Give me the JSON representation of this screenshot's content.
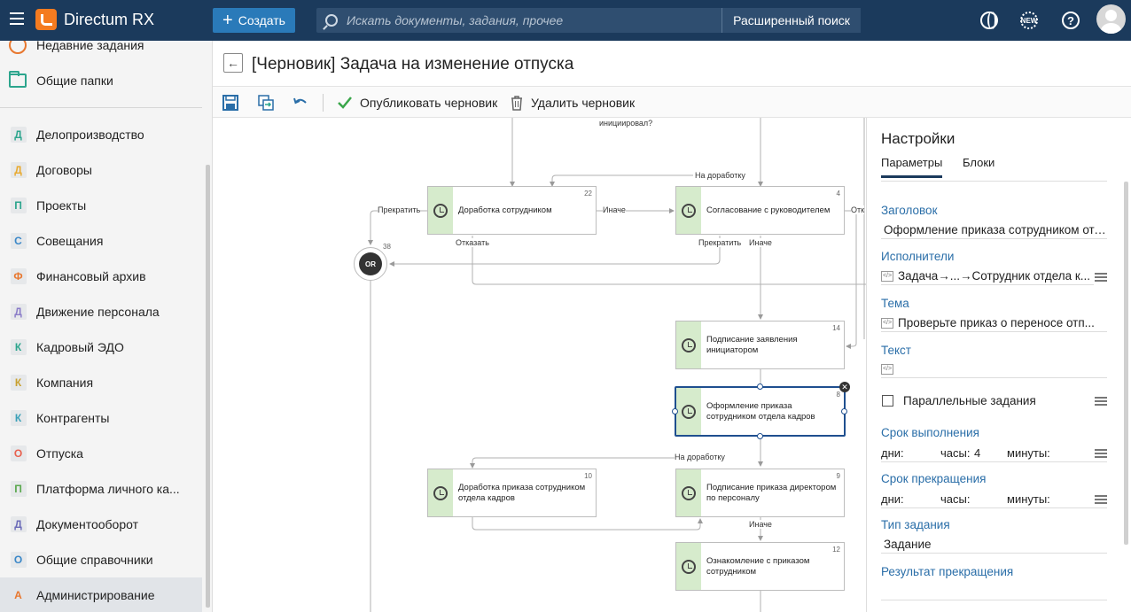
{
  "app": {
    "logo_text": "Directum RX",
    "create_label": "Создать",
    "search_placeholder": "Искать документы, задания, прочее",
    "advanced_search_label": "Расширенный поиск",
    "new_badge": "NEW",
    "help_symbol": "?"
  },
  "sidebar": {
    "top_items": [
      {
        "label": "Недавние задания",
        "icon": "clock-icon"
      },
      {
        "label": "Общие папки",
        "icon": "folder-icon"
      }
    ],
    "items": [
      {
        "letter": "Д",
        "label": "Делопроизводство",
        "color": "#2ca58d"
      },
      {
        "letter": "Д",
        "label": "Договоры",
        "color": "#e8a92e"
      },
      {
        "letter": "П",
        "label": "Проекты",
        "color": "#2ca58d"
      },
      {
        "letter": "С",
        "label": "Совещания",
        "color": "#3a87c8"
      },
      {
        "letter": "Ф",
        "label": "Финансовый архив",
        "color": "#e8772e"
      },
      {
        "letter": "Д",
        "label": "Движение персонала",
        "color": "#8a7cc8"
      },
      {
        "letter": "К",
        "label": "Кадровый ЭДО",
        "color": "#2ca58d"
      },
      {
        "letter": "К",
        "label": "Компания",
        "color": "#c8a02e"
      },
      {
        "letter": "К",
        "label": "Контрагенты",
        "color": "#3aa0b8"
      },
      {
        "letter": "О",
        "label": "Отпуска",
        "color": "#e8604e"
      },
      {
        "letter": "П",
        "label": "Платформа личного ка...",
        "color": "#5aa84e"
      },
      {
        "letter": "Д",
        "label": "Документооборот",
        "color": "#6a6ab8"
      },
      {
        "letter": "О",
        "label": "Общие справочники",
        "color": "#3a87c8"
      },
      {
        "letter": "А",
        "label": "Администрирование",
        "color": "#e8772e"
      }
    ]
  },
  "header": {
    "title": "[Черновик] Задача на изменение отпуска"
  },
  "toolbar": {
    "publish_label": "Опубликовать черновик",
    "delete_label": "Удалить черновик"
  },
  "scheme": {
    "blocks": [
      {
        "id": "b22",
        "num": "22",
        "title": "Доработка сотрудником"
      },
      {
        "id": "b4",
        "num": "4",
        "title": "Согласование с руководителем"
      },
      {
        "id": "b14",
        "num": "14",
        "title": "Подписание заявления инициатором"
      },
      {
        "id": "b8",
        "num": "8",
        "title": "Оформление приказа сотрудником отдела кадров"
      },
      {
        "id": "b10",
        "num": "10",
        "title": "Доработка приказа сотрудником отдела кадров"
      },
      {
        "id": "b9",
        "num": "9",
        "title": "Подписание приказа директором по персоналу"
      },
      {
        "id": "b12",
        "num": "12",
        "title": "Ознакомление с приказом сотрудником"
      }
    ],
    "or_node": {
      "label": "OR",
      "num": "38"
    },
    "edge_labels": {
      "initiated": "инициировал?",
      "rework_top": "На доработку",
      "stop_left": "Прекратить",
      "otherwise_1": "Иначе",
      "otk": "Отк",
      "refuse": "Отказать",
      "stop_mid": "Прекратить",
      "otherwise_2": "Иначе",
      "rework_mid": "На доработку",
      "otherwise_3": "Иначе"
    }
  },
  "panel": {
    "title": "Настройки",
    "tabs": [
      "Параметры",
      "Блоки"
    ],
    "fields": {
      "heading_label": "Заголовок",
      "heading_value": "Оформление приказа сотрудником отдела кадров",
      "performers_label": "Исполнители",
      "performers_value": "Задача→...→Сотрудник отдела к...",
      "subject_label": "Тема",
      "subject_value": "Проверьте приказ о переносе отп...",
      "text_label": "Текст",
      "text_value": "",
      "parallel_label": "Параллельные задания",
      "deadline_label": "Срок выполнения",
      "days_label": "дни:",
      "hours_label": "часы:",
      "hours_value": "4",
      "minutes_label": "минуты:",
      "abort_label": "Срок прекращения",
      "abort_days_label": "дни:",
      "abort_hours_label": "часы:",
      "abort_minutes_label": "минуты:",
      "task_type_label": "Тип задания",
      "task_type_value": "Задание",
      "abort_result_label": "Результат прекращения"
    }
  }
}
